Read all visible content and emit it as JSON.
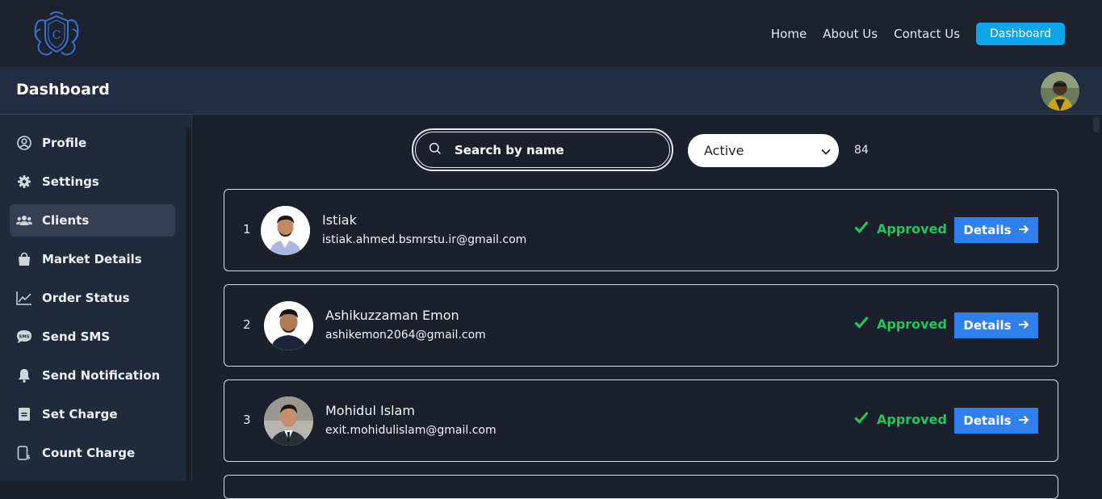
{
  "nav": {
    "links": [
      "Home",
      "About Us",
      "Contact Us"
    ],
    "dashboard_button": "Dashboard",
    "accent": "#0ea5e9"
  },
  "header": {
    "title": "Dashboard"
  },
  "sidebar": {
    "items": [
      {
        "label": "Profile",
        "icon": "user-circle-icon"
      },
      {
        "label": "Settings",
        "icon": "gear-icon"
      },
      {
        "label": "Clients",
        "icon": "users-icon",
        "active": true
      },
      {
        "label": "Market Details",
        "icon": "shopping-bag-icon"
      },
      {
        "label": "Order Status",
        "icon": "line-chart-icon"
      },
      {
        "label": "Send SMS",
        "icon": "sms-icon"
      },
      {
        "label": "Send Notification",
        "icon": "bell-icon"
      },
      {
        "label": "Set Charge",
        "icon": "document-icon"
      },
      {
        "label": "Count Charge",
        "icon": "charge-icon"
      }
    ]
  },
  "filters": {
    "search_placeholder": "Search by name",
    "status_selected": "Active",
    "count": "84"
  },
  "clients": [
    {
      "index": "1",
      "name": "Istiak",
      "email": "istiak.ahmed.bsmrstu.ir@gmail.com",
      "status": "Approved",
      "action": "Details"
    },
    {
      "index": "2",
      "name": "Ashikuzzaman Emon",
      "email": "ashikemon2064@gmail.com",
      "status": "Approved",
      "action": "Details"
    },
    {
      "index": "3",
      "name": "Mohidul Islam",
      "email": "exit.mohidulislam@gmail.com",
      "status": "Approved",
      "action": "Details"
    }
  ],
  "colors": {
    "approved": "#22c55e",
    "details_button": "#2f80ed",
    "background": "#1b202c"
  }
}
